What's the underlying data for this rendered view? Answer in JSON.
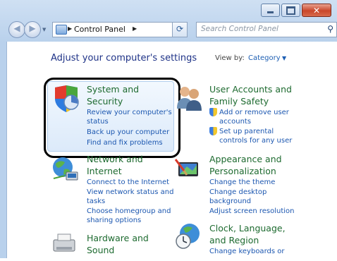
{
  "window": {
    "controls": [
      "minimize",
      "maximize",
      "close"
    ]
  },
  "nav": {
    "back_icon": "back-arrow-icon",
    "forward_icon": "forward-arrow-icon",
    "breadcrumb": "Control Panel",
    "search_placeholder": "Search Control Panel"
  },
  "header": {
    "title": "Adjust your computer's settings",
    "view_by_label": "View by:",
    "view_by_value": "Category"
  },
  "categories": {
    "system": {
      "title_line1": "System and",
      "title_line2": "Security",
      "links": [
        "Review your computer's",
        "status",
        "Back up your computer",
        "Find and fix problems"
      ]
    },
    "user": {
      "title_line1": "User Accounts and",
      "title_line2": "Family Safety",
      "links": [
        "Add or remove user",
        "accounts",
        "Set up parental",
        "controls for any user"
      ]
    },
    "network": {
      "title_line1": "Network and",
      "title_line2": "Internet",
      "links": [
        "Connect to the Internet",
        "View network status and",
        "tasks",
        "Choose homegroup and",
        "sharing options"
      ]
    },
    "appearance": {
      "title_line1": "Appearance and",
      "title_line2": "Personalization",
      "links": [
        "Change the theme",
        "Change desktop",
        "background",
        "Adjust screen resolution"
      ]
    },
    "hardware": {
      "title_line1": "Hardware and",
      "title_line2": "Sound"
    },
    "clock": {
      "title_line1": "Clock, Language,",
      "title_line2": "and Region",
      "links": [
        "Change keyboards or"
      ]
    }
  },
  "colors": {
    "link": "#1c57b0",
    "category_title": "#1d6a2f",
    "heading": "#1e3287"
  }
}
